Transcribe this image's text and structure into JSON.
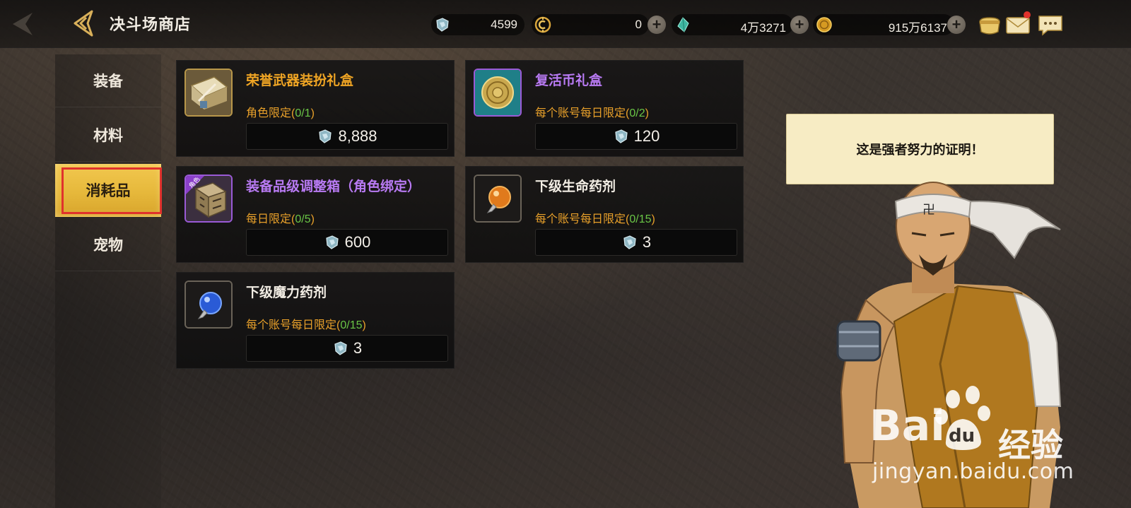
{
  "header": {
    "title": "决斗场商店"
  },
  "currencies": [
    {
      "icon": "duel-crystal-icon",
      "value": "4599"
    },
    {
      "icon": "c-coin-icon",
      "value": "0"
    },
    {
      "icon": "green-gem-icon",
      "value": "4万3271"
    },
    {
      "icon": "gold-coin-icon",
      "value": "915万6137"
    }
  ],
  "sidebar": {
    "items": [
      {
        "label": "装备",
        "active": false
      },
      {
        "label": "材料",
        "active": false
      },
      {
        "label": "消耗品",
        "active": true
      },
      {
        "label": "宠物",
        "active": false
      }
    ]
  },
  "items": [
    {
      "name": "荣誉武器装扮礼盒",
      "limit_label": "角色限定(",
      "limit_count": "0/1",
      "limit_end": ")",
      "price": "8,888",
      "rarity": "orange",
      "icon": "weapon-gift-box-icon"
    },
    {
      "name": "复活币礼盒",
      "limit_label": "每个账号每日限定(",
      "limit_count": "0/2",
      "limit_end": ")",
      "price": "120",
      "rarity": "purple",
      "icon": "revival-coin-box-icon"
    },
    {
      "name": "装备品级调整箱（角色绑定）",
      "limit_label": "每日限定(",
      "limit_count": "0/5",
      "limit_end": ")",
      "price": "600",
      "rarity": "purple",
      "icon": "grade-adjust-box-icon",
      "badge": "角色"
    },
    {
      "name": "下级生命药剂",
      "limit_label": "每个账号每日限定(",
      "limit_count": "0/15",
      "limit_end": ")",
      "price": "3",
      "rarity": "white",
      "icon": "hp-potion-icon"
    },
    {
      "name": "下级魔力药剂",
      "limit_label": "每个账号每日限定(",
      "limit_count": "0/15",
      "limit_end": ")",
      "price": "3",
      "rarity": "white",
      "icon": "mp-potion-icon"
    }
  ],
  "npc": {
    "speech": "这是强者努力的证明！"
  },
  "watermark": {
    "brand": "Bai",
    "brand2": "du",
    "suffix": "经验",
    "url": "jingyan.baidu.com"
  },
  "colors": {
    "accent_gold": "#f2c84f",
    "limit_orange": "#e8a02a",
    "count_green": "#6ac646",
    "rarity_orange": "#f0a524",
    "rarity_purple": "#b87af3",
    "highlight_red": "#e0322c"
  }
}
